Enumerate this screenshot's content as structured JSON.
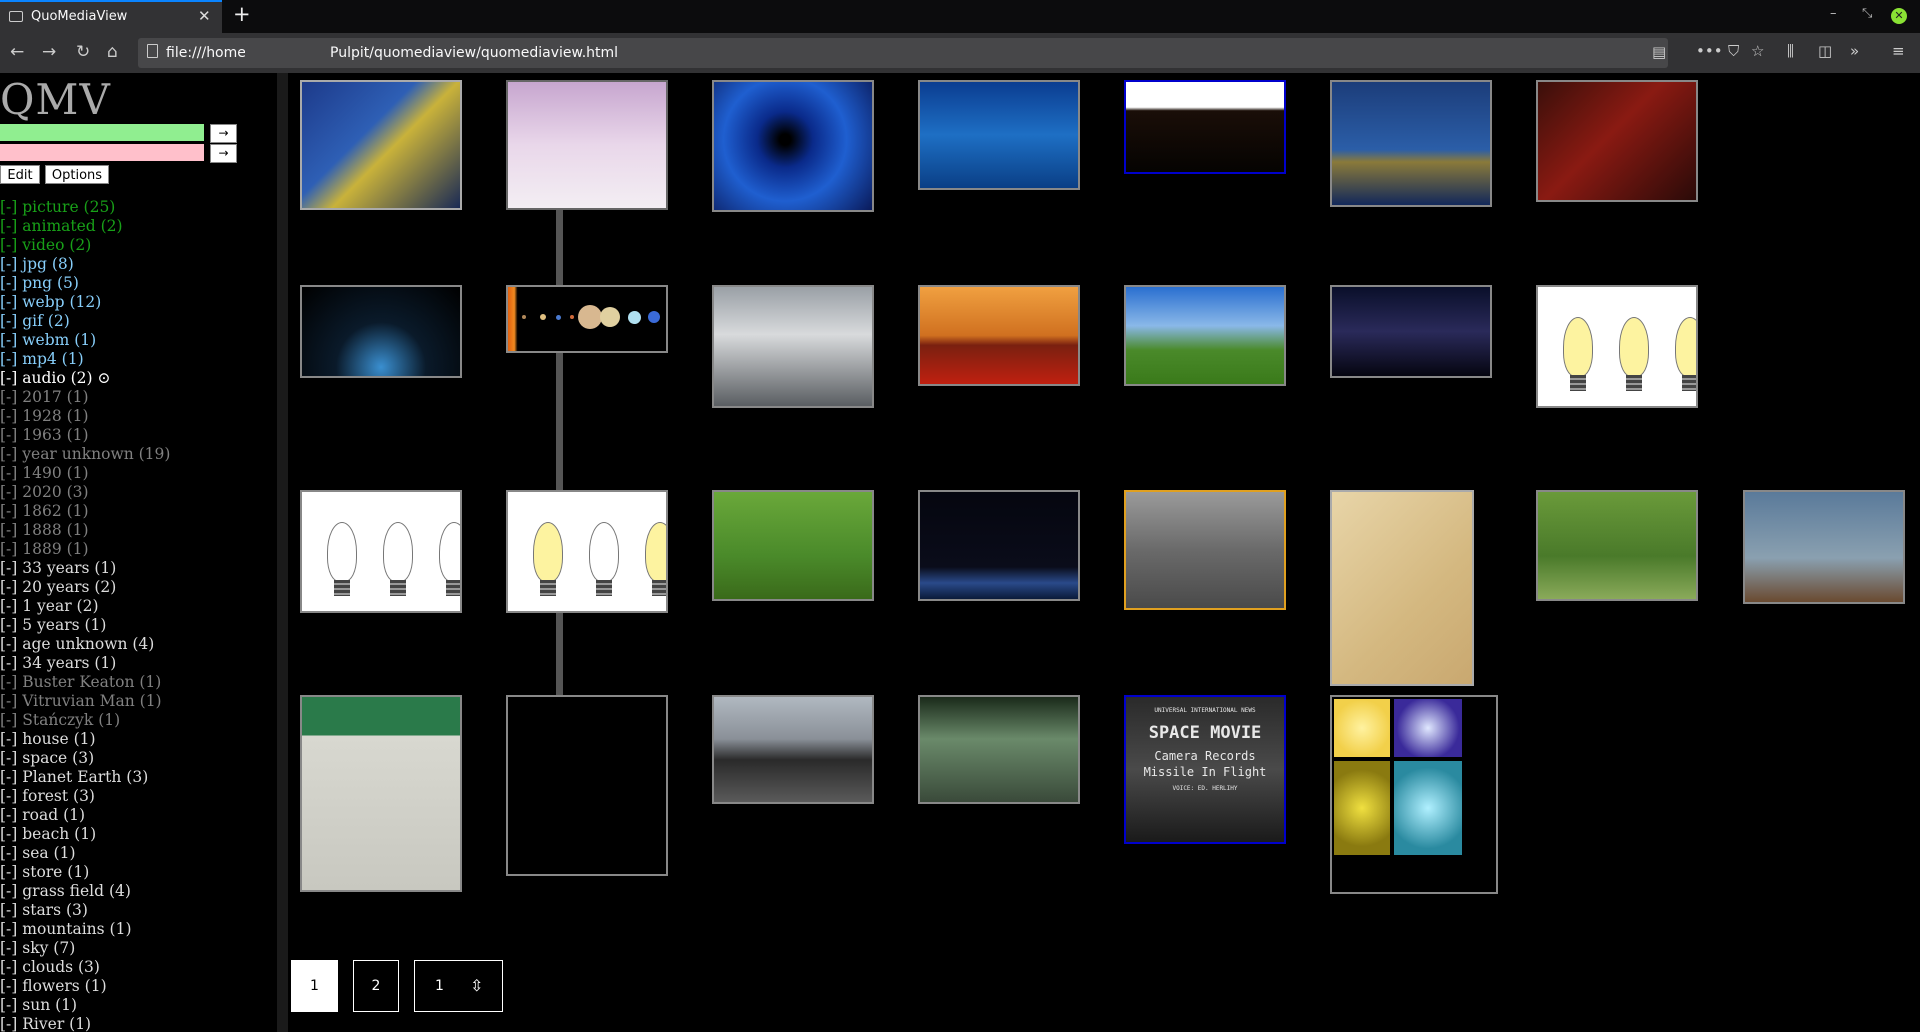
{
  "browser": {
    "tab_title": "QuoMediaView",
    "url_prefix": "file:///home",
    "url_path": "Pulpit/quomediaview/quomediaview.html"
  },
  "app": {
    "logo": "QMV",
    "go_label": "→",
    "edit_label": "Edit",
    "options_label": "Options"
  },
  "tags": [
    {
      "text": "[-] picture (25)",
      "color": "#18a018"
    },
    {
      "text": "[-] animated (2)",
      "color": "#18a018"
    },
    {
      "text": "[-] video (2)",
      "color": "#18a018"
    },
    {
      "text": "[-] jpg (8)",
      "color": "#87cefa"
    },
    {
      "text": "[-] png (5)",
      "color": "#87cefa"
    },
    {
      "text": "[-] webp (12)",
      "color": "#87cefa"
    },
    {
      "text": "[-] gif (2)",
      "color": "#87cefa"
    },
    {
      "text": "[-] webm (1)",
      "color": "#87cefa"
    },
    {
      "text": "[-] mp4 (1)",
      "color": "#87cefa"
    },
    {
      "text": "[-] audio (2) ⊙",
      "color": "#ffffff"
    },
    {
      "text": "[-] 2017 (1)",
      "color": "#808080"
    },
    {
      "text": "[-] 1928 (1)",
      "color": "#808080"
    },
    {
      "text": "[-] 1963 (1)",
      "color": "#808080"
    },
    {
      "text": "[-] year unknown (19)",
      "color": "#808080"
    },
    {
      "text": "[-] 1490 (1)",
      "color": "#808080"
    },
    {
      "text": "[-] 2020 (3)",
      "color": "#808080"
    },
    {
      "text": "[-] 1862 (1)",
      "color": "#808080"
    },
    {
      "text": "[-] 1888 (1)",
      "color": "#808080"
    },
    {
      "text": "[-] 1889 (1)",
      "color": "#808080"
    },
    {
      "text": "[-] 33 years (1)",
      "color": "#dddddd"
    },
    {
      "text": "[-] 20 years (2)",
      "color": "#dddddd"
    },
    {
      "text": "[-] 1 year (2)",
      "color": "#dddddd"
    },
    {
      "text": "[-] 5 years (1)",
      "color": "#dddddd"
    },
    {
      "text": "[-] age unknown (4)",
      "color": "#dddddd"
    },
    {
      "text": "[-] 34 years (1)",
      "color": "#dddddd"
    },
    {
      "text": "[-] Buster Keaton (1)",
      "color": "#808080"
    },
    {
      "text": "[-] Vitruvian Man (1)",
      "color": "#808080"
    },
    {
      "text": "[-] Stańczyk (1)",
      "color": "#808080"
    },
    {
      "text": "[-] house (1)",
      "color": "#dddddd"
    },
    {
      "text": "[-] space (3)",
      "color": "#dddddd"
    },
    {
      "text": "[-] Planet Earth (3)",
      "color": "#dddddd"
    },
    {
      "text": "[-] forest (3)",
      "color": "#dddddd"
    },
    {
      "text": "[-] road (1)",
      "color": "#dddddd"
    },
    {
      "text": "[-] beach (1)",
      "color": "#dddddd"
    },
    {
      "text": "[-] sea (1)",
      "color": "#dddddd"
    },
    {
      "text": "[-] store (1)",
      "color": "#dddddd"
    },
    {
      "text": "[-] grass field (4)",
      "color": "#dddddd"
    },
    {
      "text": "[-] stars (3)",
      "color": "#dddddd"
    },
    {
      "text": "[-] mountains (1)",
      "color": "#dddddd"
    },
    {
      "text": "[-] sky (7)",
      "color": "#dddddd"
    },
    {
      "text": "[-] clouds (3)",
      "color": "#dddddd"
    },
    {
      "text": "[-] flowers (1)",
      "color": "#dddddd"
    },
    {
      "text": "[-] sun (1)",
      "color": "#dddddd"
    },
    {
      "text": "[-] River (1)",
      "color": "#dddddd"
    }
  ],
  "gallery": [
    {
      "name": "starry-night",
      "border": "#aaaaaa",
      "bg": "linear-gradient(135deg,#1d3a8a,#2e5fb5 40%,#c9b23a 55%,#1a2a55)"
    },
    {
      "name": "pegasus",
      "border": "#666666",
      "bg": "linear-gradient(180deg,#c7a6cf,#e9d7ea 50%,#f3eef3)"
    },
    {
      "name": "blue-fractal",
      "border": "#888888",
      "bg": "radial-gradient(circle at 45% 45%,#000 5%,#0a2a8a 25%,#1f5fd0 55%,#0a1a5a)"
    },
    {
      "name": "swan",
      "border": "#888888",
      "bg": "linear-gradient(180deg,#0b3d91,#1e6fc4 50%,#0a3f86)"
    },
    {
      "name": "video-dark",
      "border": "#0000cc",
      "bg": "linear-gradient(180deg,#ffffff 0%,#ffffff 28%,#1a0e08 32%,#050301)"
    },
    {
      "name": "starry-night-rhone",
      "border": "#888888",
      "bg": "linear-gradient(180deg,#1c3d7a,#2b5ea8 55%,#8a7a3a 65%,#12285a)"
    },
    {
      "name": "stanczyk",
      "border": "#888888",
      "bg": "linear-gradient(135deg,#3a0f0a,#8a1a12 45%,#2a0a08)"
    },
    {
      "name": "spaceship",
      "border": "#888888",
      "bg": "radial-gradient(circle at 50% 90%,#3a8fd0,#0a1a2a 40%,#000)"
    },
    {
      "name": "solar-system",
      "border": "#888888",
      "bg": "linear-gradient(90deg,#e06010 0%,#f08a20 4%,#000 6%,#000)"
    },
    {
      "name": "clouds",
      "border": "#888888",
      "bg": "linear-gradient(180deg,#9aa0a6,#d8dadc 40%,#5a5e62)"
    },
    {
      "name": "poppy-field",
      "border": "#888888",
      "bg": "linear-gradient(180deg,#f0a040,#d07020 50%,#7a2010 60%,#c02010)"
    },
    {
      "name": "mountains",
      "border": "#888888",
      "bg": "linear-gradient(180deg,#2a6fd0,#8ab8e8 40%,#4a8a2a 65%,#3a7a1a)"
    },
    {
      "name": "milky-way",
      "border": "#888888",
      "bg": "linear-gradient(180deg,#0a0f2a,#2a2a5a 50%,#050510)"
    },
    {
      "name": "bulbs-lit",
      "border": "#888888",
      "bg": "#ffffff"
    },
    {
      "name": "bulbs-off",
      "border": "#888888",
      "bg": "#ffffff"
    },
    {
      "name": "bulbs-mixed",
      "border": "#888888",
      "bg": "#ffffff"
    },
    {
      "name": "kitten",
      "border": "#888888",
      "bg": "linear-gradient(180deg,#6aa83a,#4a8a2a 60%,#3a6a1a)"
    },
    {
      "name": "earth-space",
      "border": "#888888",
      "bg": "linear-gradient(180deg,#05060f,#0a0c1a 70%,#2a4a8a 85%,#0a1a3a)"
    },
    {
      "name": "buster-keaton-house",
      "border": "#e0a020",
      "bg": "linear-gradient(180deg,#9a9a9a,#6a6a6a 50%,#4a4a4a)"
    },
    {
      "name": "vitruvian-man",
      "border": "#aaaaaa",
      "bg": "linear-gradient(135deg,#e8d5a8,#d4b880 60%,#c9a870)"
    },
    {
      "name": "cats",
      "border": "#888888",
      "bg": "linear-gradient(180deg,#6a9a3a,#4a7a2a 60%,#8aaa5a)"
    },
    {
      "name": "bird",
      "border": "#888888",
      "bg": "linear-gradient(180deg,#5a7a9a,#8aa0b0 60%,#6a4a30)"
    },
    {
      "name": "cyclist-store",
      "border": "#888888",
      "bg": "linear-gradient(180deg,#2a7a4a 0%,#2a7a4a 20%,#d8d8d0 20%,#c8c8c0)"
    },
    {
      "name": "cyclist-black",
      "border": "#888888",
      "bg": "#000000"
    },
    {
      "name": "beach",
      "border": "#888888",
      "bg": "linear-gradient(180deg,#b0b8c0,#8a9098 40%,#2a2a2a 60%,#5a5a5a)"
    },
    {
      "name": "forest-road",
      "border": "#888888",
      "bg": "linear-gradient(180deg,#1a2a1a,#6a8a6a 40%,#3a4a3a)"
    },
    {
      "name": "space-movie",
      "border": "#0000cc",
      "bg": "linear-gradient(180deg,#2a2a2a,#4a4a4a 50%,#1a1a1a)"
    },
    {
      "name": "fantasy-collage",
      "border": "#888888",
      "bg": "#000000"
    }
  ],
  "space_movie": {
    "l1": "UNIVERSAL INTERNATIONAL NEWS",
    "l2": "SPACE MOVIE",
    "l3": "Camera Records",
    "l4": "Missile In Flight",
    "l5": "VOICE: ED. HERLIHY"
  },
  "pagination": {
    "p1": "1",
    "p2": "2",
    "select_value": "1",
    "select_icon": "⇳"
  }
}
